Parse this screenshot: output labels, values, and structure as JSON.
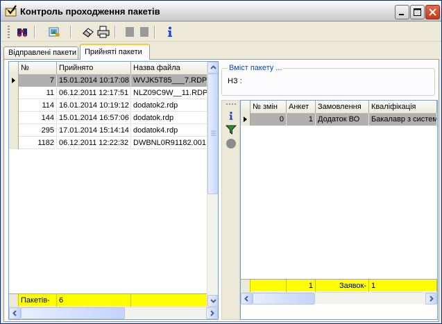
{
  "window": {
    "title": "Контроль проходження пакетів"
  },
  "tabs": [
    {
      "label": "Відправлені пакети",
      "active": false
    },
    {
      "label": "Прийняті пакети",
      "active": true
    }
  ],
  "left_grid": {
    "columns": [
      "№",
      "Прийнято",
      "Назва файла"
    ],
    "rows": [
      {
        "num": "7",
        "received": "15.01.2014 10:17:08",
        "file": "WVJK5T85___7.RDP",
        "selected": true
      },
      {
        "num": "11",
        "received": "06.12.2011 12:17:51",
        "file": "NLZ09C9W__11.RDP",
        "selected": false
      },
      {
        "num": "114",
        "received": "16.01.2014 10:19:12",
        "file": "dodatok2.rdp",
        "selected": false
      },
      {
        "num": "144",
        "received": "15.01.2014 16:57:06",
        "file": "dodatok.rdp",
        "selected": false
      },
      {
        "num": "295",
        "received": "17.01.2014 15:14:14",
        "file": "dodatok4.rdp",
        "selected": false
      },
      {
        "num": "1182",
        "received": "06.12.2011 12:22:32",
        "file": "DWBNL0R91182.001",
        "selected": false
      }
    ],
    "footer": {
      "label": "Пакетів-",
      "count": "6"
    }
  },
  "right_panel": {
    "group_title": "Вміст пакету ...",
    "nz_label": "НЗ :",
    "columns": [
      "№ змін",
      "Анкет",
      "Замовлення",
      "Кваліфікація"
    ],
    "rows": [
      {
        "changes": "0",
        "forms": "1",
        "order": "Додаток ВО",
        "qualification": "Бакалавр з систем",
        "selected": true
      }
    ],
    "footer": {
      "forms_total": "1",
      "label": "Заявок-",
      "count": "1"
    }
  },
  "colors": {
    "footer_bg": "#ffff00",
    "selected_row": "#b0b0b0",
    "group_title": "#0046d5",
    "info_icon": "#1a3fd0"
  },
  "icons": {
    "toolbar": [
      "binoculars-icon",
      "refresh-icon",
      "eraser-icon",
      "print-icon",
      "disabled-stop-icon",
      "disabled-stop-icon",
      "info-icon"
    ],
    "side_strip": [
      "info-icon",
      "filter-icon",
      "status-circle-icon"
    ]
  }
}
